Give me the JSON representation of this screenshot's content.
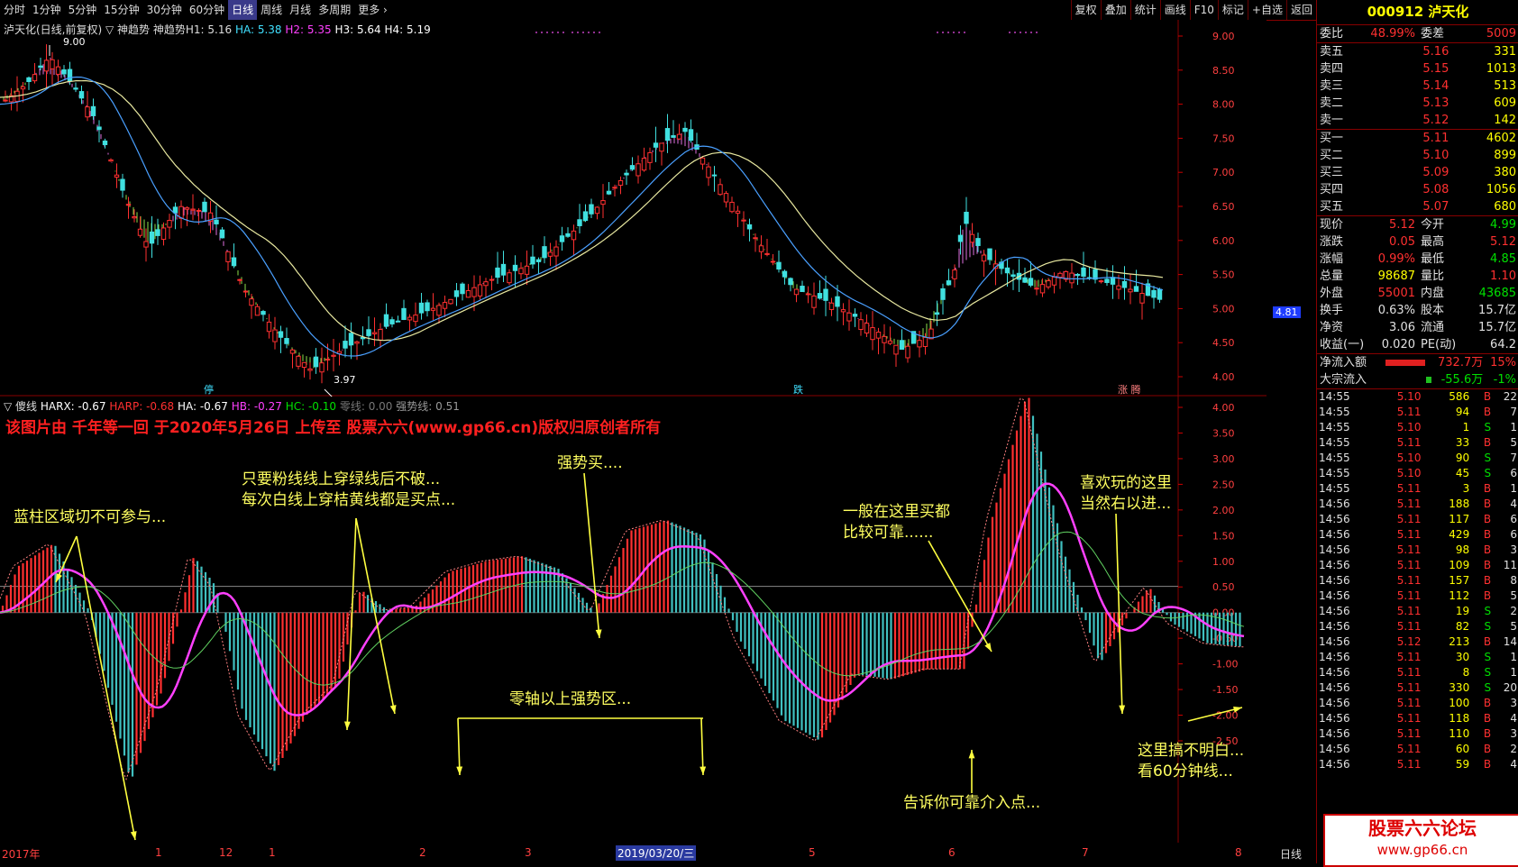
{
  "toolbar": {
    "periods": [
      "分时",
      "1分钟",
      "5分钟",
      "15分钟",
      "30分钟",
      "60分钟",
      "日线",
      "周线",
      "月线",
      "多周期",
      "更多 ›"
    ],
    "active": "日线",
    "right_buttons": [
      "复权",
      "叠加",
      "统计",
      "画线",
      "F10",
      "标记",
      "+自选",
      "返回"
    ]
  },
  "main": {
    "header_name": "泸天化(日线,前复权)",
    "indicator": "▽ 神趋势  神趋势H1: 5.16",
    "ha": "HA: 5.38",
    "h2": "H2: 5.35",
    "h3": "H3: 5.64",
    "h4": "H4: 5.19",
    "high_label": "9.00",
    "low_label": "3.97",
    "price_axis": [
      "9.00",
      "8.50",
      "8.00",
      "7.50",
      "7.00",
      "6.50",
      "6.00",
      "5.50",
      "5.00",
      "4.50",
      "4.00"
    ],
    "current_price": "4.81",
    "tags": [
      "停",
      "跌",
      "涨 腾"
    ]
  },
  "sub": {
    "title": "▽ 傻线",
    "harx": "HARX: -0.67",
    "harp": "HARP: -0.68",
    "ha": "HA: -0.67",
    "hb": "HB: -0.27",
    "hc": "HC: -0.10",
    "zero": "零线: 0.00",
    "strong": "强势线: 0.51",
    "axis": [
      "4.00",
      "3.50",
      "3.00",
      "2.50",
      "2.00",
      "1.50",
      "1.00",
      "0.50",
      "0.00",
      "-0.50",
      "-1.00",
      "-1.50",
      "-2.00",
      "-2.50"
    ],
    "banner": "该图片由 千年等一回 于2020年5月26日 上传至 股票六六(www.gp66.cn)版权归原创者所有"
  },
  "annotations": {
    "a1": "蓝柱区域切不可参与...",
    "a2_1": "只要粉线线上穿绿线后不破...",
    "a2_2": "每次白线上穿桔黄线都是买点...",
    "a3": "强势买....",
    "a4": "零轴以上强势区...",
    "a5_1": "一般在这里买都",
    "a5_2": "比较可靠......",
    "a6": "告诉你可靠介入点...",
    "a7_1": "喜欢玩的这里",
    "a7_2": "当然右以进...",
    "a8_1": "这里搞不明白...",
    "a8_2": "看60分钟线..."
  },
  "date_axis": {
    "labels": [
      "2017年",
      "1",
      "12",
      "1",
      "2",
      "3",
      "2019/03/20/三",
      "5",
      "6",
      "7",
      "8"
    ],
    "period": "日线"
  },
  "quote": {
    "title": "000912 泸天化",
    "weibi_label": "委比",
    "weibi": "48.99%",
    "weicha_label": "委差",
    "weicha": "5009",
    "asks": [
      {
        "label": "卖五",
        "price": "5.16",
        "vol": "331"
      },
      {
        "label": "卖四",
        "price": "5.15",
        "vol": "1013"
      },
      {
        "label": "卖三",
        "price": "5.14",
        "vol": "513"
      },
      {
        "label": "卖二",
        "price": "5.13",
        "vol": "609"
      },
      {
        "label": "卖一",
        "price": "5.12",
        "vol": "142"
      }
    ],
    "bids": [
      {
        "label": "买一",
        "price": "5.11",
        "vol": "4602"
      },
      {
        "label": "买二",
        "price": "5.10",
        "vol": "899"
      },
      {
        "label": "买三",
        "price": "5.09",
        "vol": "380"
      },
      {
        "label": "买四",
        "price": "5.08",
        "vol": "1056"
      },
      {
        "label": "买五",
        "price": "5.07",
        "vol": "680"
      }
    ],
    "stats": [
      {
        "l1": "现价",
        "v1": "5.12",
        "l2": "今开",
        "v2": "4.99",
        "c1": "red",
        "c2": "green"
      },
      {
        "l1": "涨跌",
        "v1": "0.05",
        "l2": "最高",
        "v2": "5.12",
        "c1": "red",
        "c2": "red"
      },
      {
        "l1": "涨幅",
        "v1": "0.99%",
        "l2": "最低",
        "v2": "4.85",
        "c1": "red",
        "c2": "green"
      },
      {
        "l1": "总量",
        "v1": "98687",
        "l2": "量比",
        "v2": "1.10",
        "c1": "yellow",
        "c2": "red"
      },
      {
        "l1": "外盘",
        "v1": "55001",
        "l2": "内盘",
        "v2": "43685",
        "c1": "red",
        "c2": "green"
      },
      {
        "l1": "换手",
        "v1": "0.63%",
        "l2": "股本",
        "v2": "15.7亿",
        "c1": "white",
        "c2": "white"
      },
      {
        "l1": "净资",
        "v1": "3.06",
        "l2": "流通",
        "v2": "15.7亿",
        "c1": "white",
        "c2": "white"
      },
      {
        "l1": "收益(一)",
        "v1": "0.020",
        "l2": "PE(动)",
        "v2": "64.2",
        "c1": "white",
        "c2": "white"
      }
    ],
    "flow1_label": "净流入额",
    "flow1_val": "732.7万",
    "flow1_pct": "15%",
    "flow2_label": "大宗流入",
    "flow2_val": "-55.6万",
    "flow2_pct": "-1%"
  },
  "ticks": [
    {
      "t": "14:55",
      "p": "5.10",
      "v": "586",
      "s": "B",
      "n": "22"
    },
    {
      "t": "14:55",
      "p": "5.11",
      "v": "94",
      "s": "B",
      "n": "7"
    },
    {
      "t": "14:55",
      "p": "5.10",
      "v": "1",
      "s": "S",
      "n": "1"
    },
    {
      "t": "14:55",
      "p": "5.11",
      "v": "33",
      "s": "B",
      "n": "5"
    },
    {
      "t": "14:55",
      "p": "5.10",
      "v": "90",
      "s": "S",
      "n": "7"
    },
    {
      "t": "14:55",
      "p": "5.10",
      "v": "45",
      "s": "S",
      "n": "6"
    },
    {
      "t": "14:55",
      "p": "5.11",
      "v": "3",
      "s": "B",
      "n": "1"
    },
    {
      "t": "14:56",
      "p": "5.11",
      "v": "188",
      "s": "B",
      "n": "4"
    },
    {
      "t": "14:56",
      "p": "5.11",
      "v": "117",
      "s": "B",
      "n": "6"
    },
    {
      "t": "14:56",
      "p": "5.11",
      "v": "429",
      "s": "B",
      "n": "6"
    },
    {
      "t": "14:56",
      "p": "5.11",
      "v": "98",
      "s": "B",
      "n": "3"
    },
    {
      "t": "14:56",
      "p": "5.11",
      "v": "109",
      "s": "B",
      "n": "11"
    },
    {
      "t": "14:56",
      "p": "5.11",
      "v": "157",
      "s": "B",
      "n": "8"
    },
    {
      "t": "14:56",
      "p": "5.11",
      "v": "112",
      "s": "B",
      "n": "5"
    },
    {
      "t": "14:56",
      "p": "5.11",
      "v": "19",
      "s": "S",
      "n": "2"
    },
    {
      "t": "14:56",
      "p": "5.11",
      "v": "82",
      "s": "S",
      "n": "5"
    },
    {
      "t": "14:56",
      "p": "5.12",
      "v": "213",
      "s": "B",
      "n": "14"
    },
    {
      "t": "14:56",
      "p": "5.11",
      "v": "30",
      "s": "S",
      "n": "1"
    },
    {
      "t": "14:56",
      "p": "5.11",
      "v": "8",
      "s": "S",
      "n": "1"
    },
    {
      "t": "14:56",
      "p": "5.11",
      "v": "330",
      "s": "S",
      "n": "20"
    },
    {
      "t": "14:56",
      "p": "5.11",
      "v": "100",
      "s": "B",
      "n": "3"
    },
    {
      "t": "14:56",
      "p": "5.11",
      "v": "118",
      "s": "B",
      "n": "4"
    },
    {
      "t": "14:56",
      "p": "5.11",
      "v": "110",
      "s": "B",
      "n": "3"
    },
    {
      "t": "14:56",
      "p": "5.11",
      "v": "60",
      "s": "B",
      "n": "2"
    },
    {
      "t": "14:56",
      "p": "5.11",
      "v": "59",
      "s": "B",
      "n": "4"
    }
  ],
  "watermark": {
    "t1": "股票六六论坛",
    "t2": "www.gp66.cn"
  },
  "colors": {
    "up": "#ff3030",
    "down": "#40e0e0",
    "ma_white": "#ffffff",
    "ma_yellow": "#e8e8a0",
    "ma_blue": "#4aa0ff",
    "pink": "#ff40ff",
    "green_fill": "#8ce04a",
    "magenta_fill": "#e070e0"
  }
}
